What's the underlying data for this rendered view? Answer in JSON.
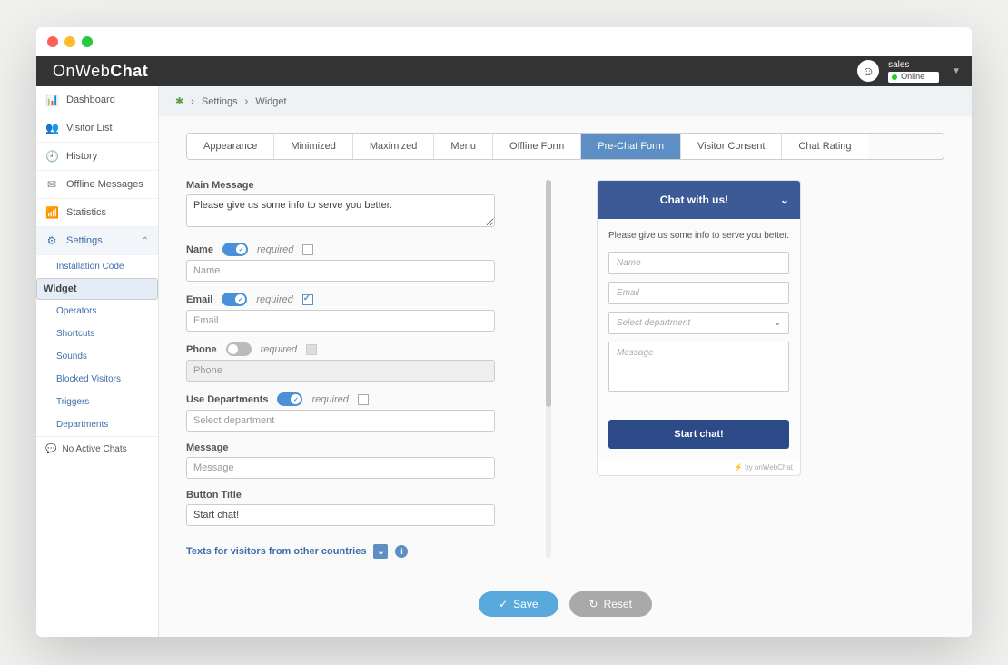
{
  "header": {
    "logo_prefix": "On",
    "logo_mid": "Web",
    "logo_suffix": "Chat",
    "user_name": "sales",
    "status": "Online"
  },
  "sidebar": {
    "items": [
      {
        "icon": "⏱",
        "label": "Dashboard"
      },
      {
        "icon": "👥",
        "label": "Visitor List"
      },
      {
        "icon": "🕘",
        "label": "History"
      },
      {
        "icon": "✉",
        "label": "Offline Messages"
      },
      {
        "icon": "📊",
        "label": "Statistics"
      },
      {
        "icon": "⚙",
        "label": "Settings"
      }
    ],
    "sub": [
      "Installation Code",
      "Widget",
      "Operators",
      "Shortcuts",
      "Sounds",
      "Blocked Visitors",
      "Triggers",
      "Departments"
    ],
    "footer": "No Active Chats"
  },
  "breadcrumb": {
    "a": "Settings",
    "b": "Widget"
  },
  "tabs": [
    "Appearance",
    "Minimized",
    "Maximized",
    "Menu",
    "Offline Form",
    "Pre-Chat Form",
    "Visitor Consent",
    "Chat Rating"
  ],
  "form": {
    "main_message_label": "Main Message",
    "main_message_value": "Please give us some info to serve you better.",
    "name_label": "Name",
    "name_ph": "Name",
    "email_label": "Email",
    "email_ph": "Email",
    "phone_label": "Phone",
    "phone_ph": "Phone",
    "dept_label": "Use Departments",
    "dept_ph": "Select department",
    "message_label": "Message",
    "message_ph": "Message",
    "button_title_label": "Button Title",
    "button_title_value": "Start chat!",
    "required": "required",
    "link": "Texts for visitors from other countries"
  },
  "preview": {
    "title": "Chat with us!",
    "msg": "Please give us some info to serve you better.",
    "name_ph": "Name",
    "email_ph": "Email",
    "dept_ph": "Select department",
    "message_ph": "Message",
    "btn": "Start chat!",
    "powered": "by onWebChat"
  },
  "actions": {
    "save": "Save",
    "reset": "Reset"
  }
}
